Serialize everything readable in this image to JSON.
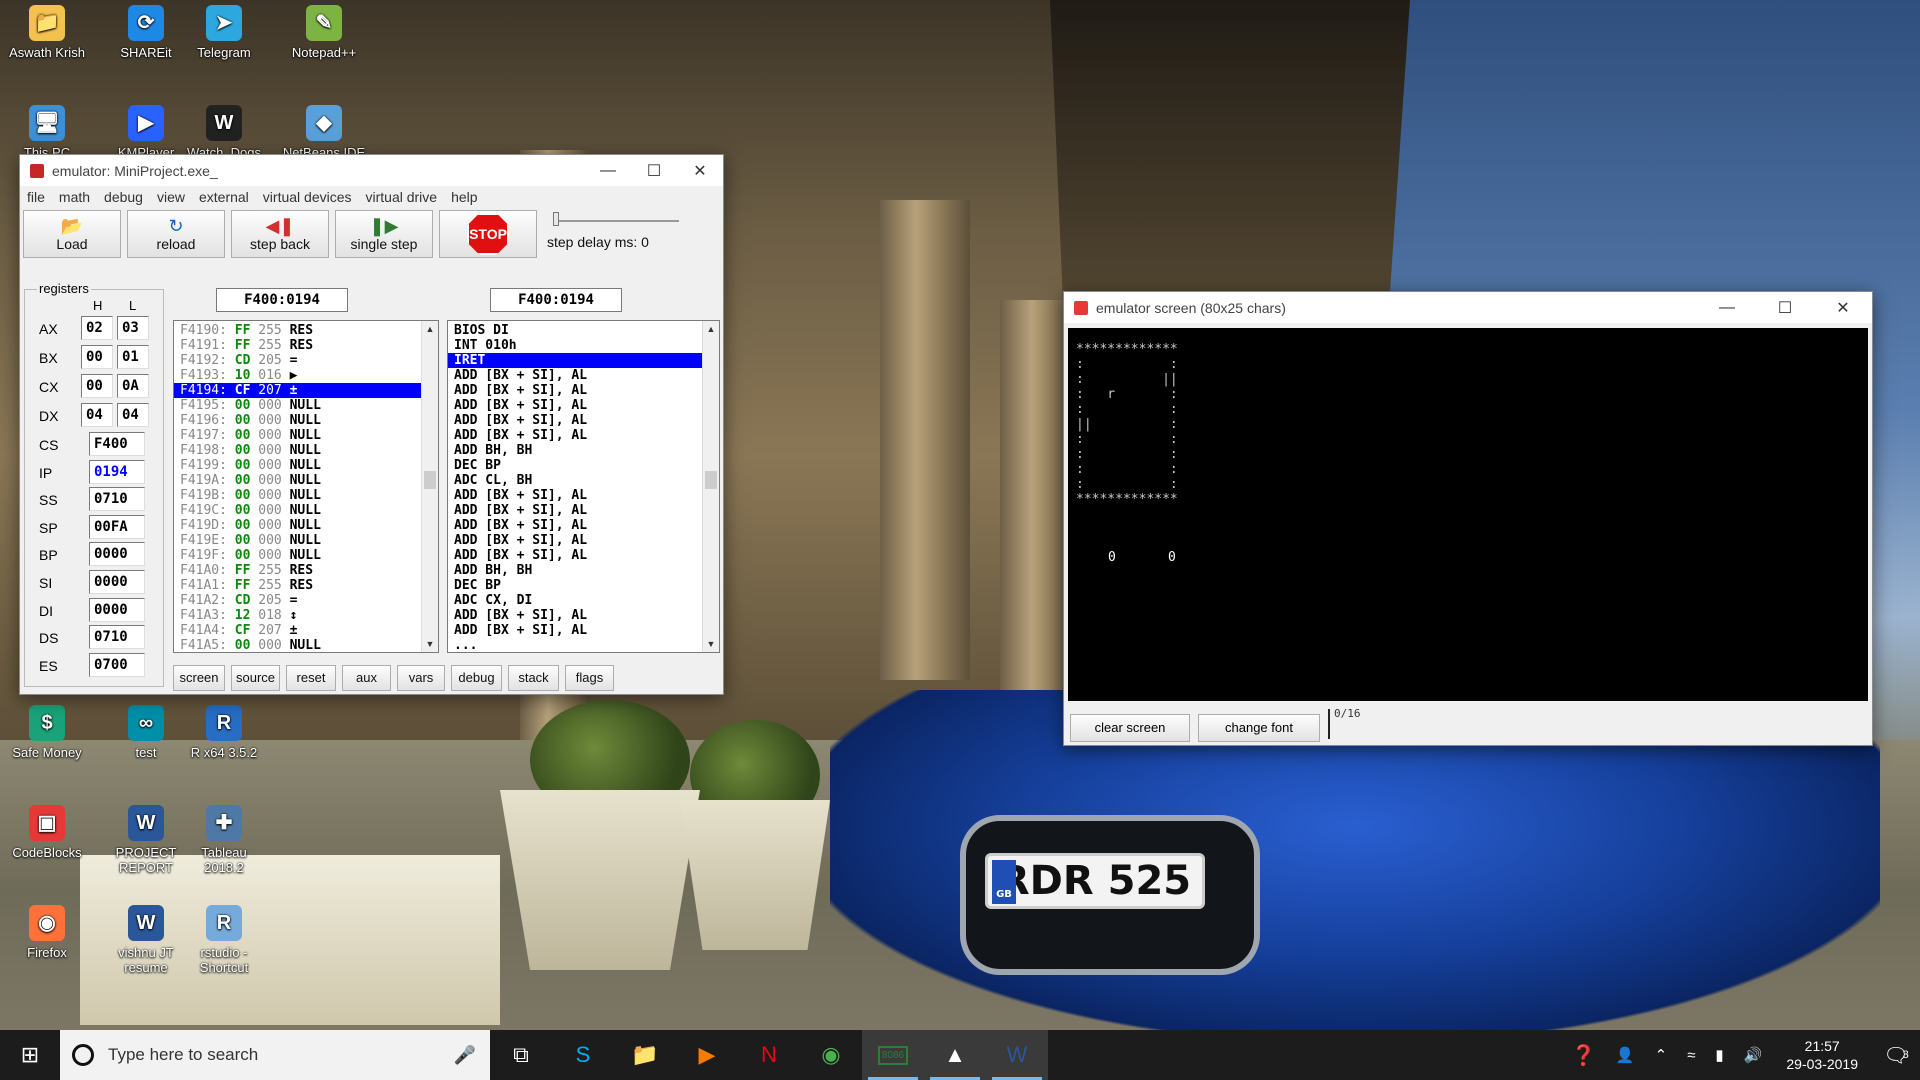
{
  "desktop_icons": [
    {
      "label": "Aswath Krish",
      "glyph": "📁",
      "color": "#f2c14e"
    },
    {
      "label": "SHAREit",
      "glyph": "⟳",
      "color": "#1e88e5"
    },
    {
      "label": "Telegram",
      "glyph": "➤",
      "color": "#2ea6de"
    },
    {
      "label": "Notepad++",
      "glyph": "✎",
      "color": "#7cb342"
    },
    {
      "label": "This PC",
      "glyph": "🖥",
      "color": "#3d8fd6"
    },
    {
      "label": "KMPlayer",
      "glyph": "▶",
      "color": "#2962ff"
    },
    {
      "label": "Watch_Dogs",
      "glyph": "W",
      "color": "#222222"
    },
    {
      "label": "NetBeans IDE",
      "glyph": "◆",
      "color": "#5aa0d8"
    },
    {
      "label": "Safe Money",
      "glyph": "$",
      "color": "#1aa37a"
    },
    {
      "label": "test",
      "glyph": "∞",
      "color": "#008fa8"
    },
    {
      "label": "R x64 3.5.2",
      "glyph": "R",
      "color": "#276dc3"
    },
    {
      "label": "CodeBlocks",
      "glyph": "▣",
      "color": "#e53935"
    },
    {
      "label": "PROJECT REPORT",
      "glyph": "W",
      "color": "#2b579a"
    },
    {
      "label": "Tableau 2018.2",
      "glyph": "✚",
      "color": "#4e79a7"
    },
    {
      "label": "Firefox",
      "glyph": "◉",
      "color": "#ff7139"
    },
    {
      "label": "vishnu JT resume",
      "glyph": "W",
      "color": "#2b579a"
    },
    {
      "label": "rstudio - Shortcut",
      "glyph": "R",
      "color": "#75aadb"
    }
  ],
  "emulator": {
    "title": "emulator: MiniProject.exe_",
    "menu": [
      "file",
      "math",
      "debug",
      "view",
      "external",
      "virtual devices",
      "virtual drive",
      "help"
    ],
    "toolbar": {
      "load": "Load",
      "reload": "reload",
      "step_back": "step back",
      "single_step": "single step",
      "stop": "STOP",
      "step_delay": "step delay ms: 0"
    },
    "registers": {
      "legend": "registers",
      "h": "H",
      "l": "L",
      "split": [
        {
          "name": "AX",
          "h": "02",
          "l": "03"
        },
        {
          "name": "BX",
          "h": "00",
          "l": "01"
        },
        {
          "name": "CX",
          "h": "00",
          "l": "0A"
        },
        {
          "name": "DX",
          "h": "04",
          "l": "04"
        }
      ],
      "full": [
        {
          "name": "CS",
          "value": "F400"
        },
        {
          "name": "IP",
          "value": "0194"
        },
        {
          "name": "SS",
          "value": "0710"
        },
        {
          "name": "SP",
          "value": "00FA"
        },
        {
          "name": "BP",
          "value": "0000"
        },
        {
          "name": "SI",
          "value": "0000"
        },
        {
          "name": "DI",
          "value": "0000"
        },
        {
          "name": "DS",
          "value": "0710"
        },
        {
          "name": "ES",
          "value": "0700"
        }
      ]
    },
    "memory_address": "F400:0194",
    "disasm_address": "F400:0194",
    "memory": [
      {
        "addr": "F4190:",
        "hex": "FF",
        "dec": "255",
        "chr": "RES"
      },
      {
        "addr": "F4191:",
        "hex": "FF",
        "dec": "255",
        "chr": "RES"
      },
      {
        "addr": "F4192:",
        "hex": "CD",
        "dec": "205",
        "chr": "="
      },
      {
        "addr": "F4193:",
        "hex": "10",
        "dec": "016",
        "chr": "▶"
      },
      {
        "addr": "F4194:",
        "hex": "CF",
        "dec": "207",
        "chr": "±",
        "selected": true
      },
      {
        "addr": "F4195:",
        "hex": "00",
        "dec": "000",
        "chr": "NULL"
      },
      {
        "addr": "F4196:",
        "hex": "00",
        "dec": "000",
        "chr": "NULL"
      },
      {
        "addr": "F4197:",
        "hex": "00",
        "dec": "000",
        "chr": "NULL"
      },
      {
        "addr": "F4198:",
        "hex": "00",
        "dec": "000",
        "chr": "NULL"
      },
      {
        "addr": "F4199:",
        "hex": "00",
        "dec": "000",
        "chr": "NULL"
      },
      {
        "addr": "F419A:",
        "hex": "00",
        "dec": "000",
        "chr": "NULL"
      },
      {
        "addr": "F419B:",
        "hex": "00",
        "dec": "000",
        "chr": "NULL"
      },
      {
        "addr": "F419C:",
        "hex": "00",
        "dec": "000",
        "chr": "NULL"
      },
      {
        "addr": "F419D:",
        "hex": "00",
        "dec": "000",
        "chr": "NULL"
      },
      {
        "addr": "F419E:",
        "hex": "00",
        "dec": "000",
        "chr": "NULL"
      },
      {
        "addr": "F419F:",
        "hex": "00",
        "dec": "000",
        "chr": "NULL"
      },
      {
        "addr": "F41A0:",
        "hex": "FF",
        "dec": "255",
        "chr": "RES"
      },
      {
        "addr": "F41A1:",
        "hex": "FF",
        "dec": "255",
        "chr": "RES"
      },
      {
        "addr": "F41A2:",
        "hex": "CD",
        "dec": "205",
        "chr": "="
      },
      {
        "addr": "F41A3:",
        "hex": "12",
        "dec": "018",
        "chr": "↕"
      },
      {
        "addr": "F41A4:",
        "hex": "CF",
        "dec": "207",
        "chr": "±"
      },
      {
        "addr": "F41A5:",
        "hex": "00",
        "dec": "000",
        "chr": "NULL"
      }
    ],
    "disasm": [
      {
        "text": "BIOS DI"
      },
      {
        "text": "INT 010h"
      },
      {
        "text": "IRET",
        "selected": true
      },
      {
        "text": "ADD [BX + SI], AL"
      },
      {
        "text": "ADD [BX + SI], AL"
      },
      {
        "text": "ADD [BX + SI], AL"
      },
      {
        "text": "ADD [BX + SI], AL"
      },
      {
        "text": "ADD [BX + SI], AL"
      },
      {
        "text": "ADD BH, BH"
      },
      {
        "text": "DEC BP"
      },
      {
        "text": "ADC CL, BH"
      },
      {
        "text": "ADD [BX + SI], AL"
      },
      {
        "text": "ADD [BX + SI], AL"
      },
      {
        "text": "ADD [BX + SI], AL"
      },
      {
        "text": "ADD [BX + SI], AL"
      },
      {
        "text": "ADD [BX + SI], AL"
      },
      {
        "text": "ADD BH, BH"
      },
      {
        "text": "DEC BP"
      },
      {
        "text": "ADC CX, DI"
      },
      {
        "text": "ADD [BX + SI], AL"
      },
      {
        "text": "ADD [BX + SI], AL"
      },
      {
        "text": "..."
      }
    ],
    "bottom_buttons": [
      "screen",
      "source",
      "reset",
      "aux",
      "vars",
      "debug",
      "stack",
      "flags"
    ]
  },
  "emulator_screen": {
    "title": "emulator screen (80x25 chars)",
    "content_lines": [
      "*************",
      ":           :",
      ":          ||",
      ":   r       :",
      ":           :",
      "||          :",
      ":           :",
      ":           :",
      ":           :",
      ":           :",
      "*************"
    ],
    "score_left": "0",
    "score_right": "0",
    "clear_screen": "clear screen",
    "change_font": "change font",
    "counter": "0/16"
  },
  "wallpaper": {
    "plate": "RDR 525",
    "plate_country": "GB"
  },
  "taskbar": {
    "search_placeholder": "Type here to search",
    "apps": [
      {
        "name": "task-view",
        "glyph": "⧉"
      },
      {
        "name": "skype",
        "glyph": "S",
        "color": "#00aff0"
      },
      {
        "name": "file-explorer",
        "glyph": "📁",
        "color": "#f2c14e"
      },
      {
        "name": "media-player",
        "glyph": "▶",
        "color": "#f57c00"
      },
      {
        "name": "netflix",
        "glyph": "N",
        "color": "#e50914"
      },
      {
        "name": "chrome",
        "glyph": "◉",
        "color": "#4caf50"
      },
      {
        "name": "emu8086",
        "glyph": "8086",
        "color": "#2e7d32",
        "active": true
      },
      {
        "name": "photos",
        "glyph": "▲",
        "color": "#ffffff",
        "active": true
      },
      {
        "name": "word",
        "glyph": "W",
        "color": "#2b579a",
        "active": true
      }
    ],
    "time": "21:57",
    "date": "29-03-2019",
    "notifications": "3"
  }
}
